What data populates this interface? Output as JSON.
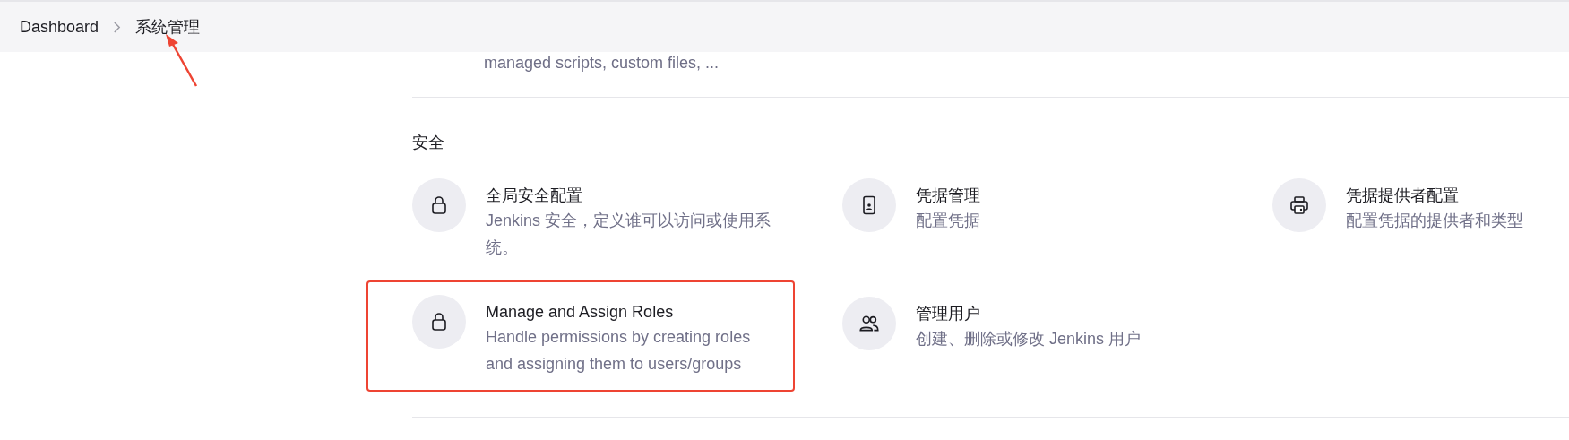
{
  "breadcrumb": [
    {
      "label": "Dashboard"
    },
    {
      "label": "系统管理"
    }
  ],
  "previous_item": {
    "description": "managed scripts, custom files, ..."
  },
  "section": {
    "title": "安全",
    "items": [
      {
        "kind": "lock",
        "title": "全局安全配置",
        "description": "Jenkins 安全，定义谁可以访问或使用系统。",
        "highlighted": false
      },
      {
        "kind": "phone",
        "title": "凭据管理",
        "description": "配置凭据",
        "highlighted": false
      },
      {
        "kind": "printer",
        "title": "凭据提供者配置",
        "description": "配置凭据的提供者和类型",
        "highlighted": false
      },
      {
        "kind": "lock",
        "title": "Manage and Assign Roles",
        "description": "Handle permissions by creating roles and assigning them to users/groups",
        "highlighted": true
      },
      {
        "kind": "users",
        "title": "管理用户",
        "description": "创建、删除或修改 Jenkins 用户",
        "highlighted": false
      }
    ]
  }
}
